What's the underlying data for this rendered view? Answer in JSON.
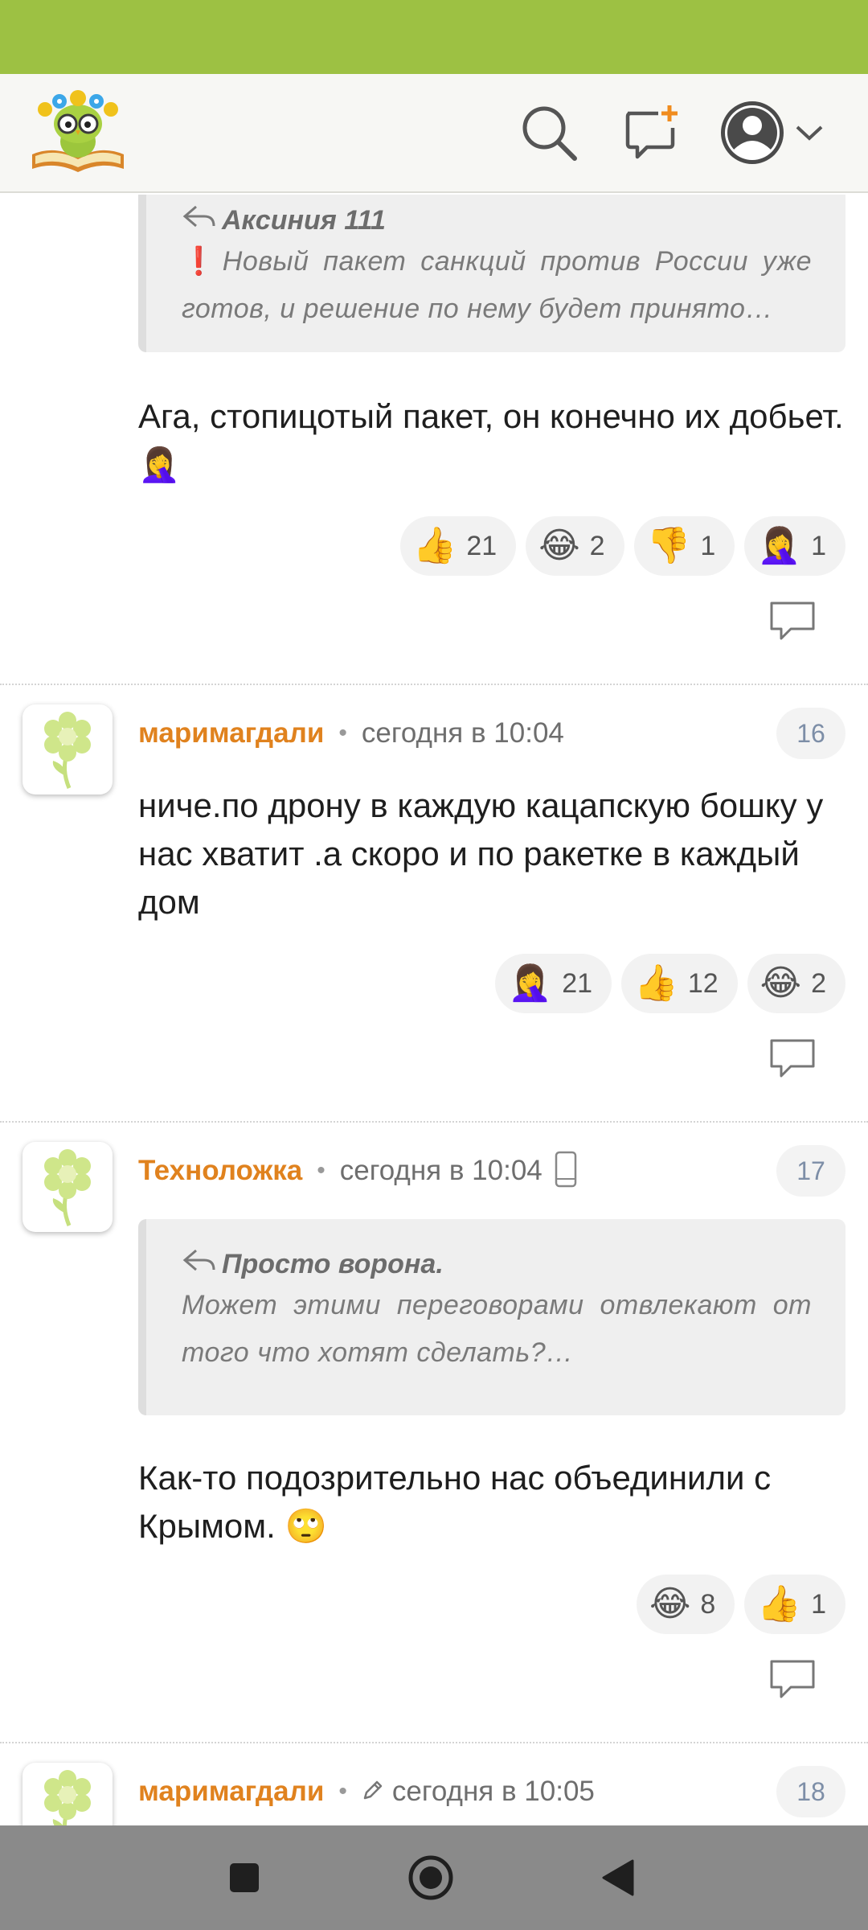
{
  "colors": {
    "accent": "#9dc143",
    "username": "#e0821e",
    "badge_text": "#7d8ea7"
  },
  "header": {
    "logo": "reading-owl-logo",
    "icons": [
      "search-icon",
      "new-post-icon",
      "profile-icon",
      "chevron-down-icon"
    ]
  },
  "comments": [
    {
      "quote": {
        "author": "Аксиния 111",
        "bang": "❗",
        "text": "Новый пакет санкций против России уже готов, и решение по нему будет принято…"
      },
      "text": "Ага, стопицотый пакет, он конечно их добьет. 🤦‍♀️",
      "reactions": [
        {
          "emoji": "👍",
          "count": "21"
        },
        {
          "emoji": "😂",
          "count": "2"
        },
        {
          "emoji": "👎",
          "count": "1"
        },
        {
          "emoji": "🤦‍♀️",
          "count": "1"
        }
      ]
    },
    {
      "author": "маримагдали",
      "time": "сегодня в 10:04",
      "number": "16",
      "text": "ниче.по дрону в каждую кацапскую бошку у нас хватит .а скоро и по ракетке в каждый дом",
      "reactions": [
        {
          "emoji": "🤦‍♀️",
          "count": "21"
        },
        {
          "emoji": "👍",
          "count": "12"
        },
        {
          "emoji": "😂",
          "count": "2"
        }
      ]
    },
    {
      "author": "Техноложка",
      "time": "сегодня в 10:04",
      "number": "17",
      "device": "mobile-device-icon",
      "quote": {
        "author": "Просто ворона.",
        "text": "Может этими переговорами отвлекают от того что хотят сделать?…"
      },
      "text": "Как-то подозрительно нас объединили с Крымом. 🙄",
      "reactions": [
        {
          "emoji": "😂",
          "count": "8"
        },
        {
          "emoji": "👍",
          "count": "1"
        }
      ]
    },
    {
      "author": "маримагдали",
      "time": "сегодня в 10:05",
      "number": "18",
      "edited": true
    }
  ],
  "navbar": {
    "icons": [
      "recent-apps-icon",
      "home-icon",
      "back-icon"
    ]
  }
}
